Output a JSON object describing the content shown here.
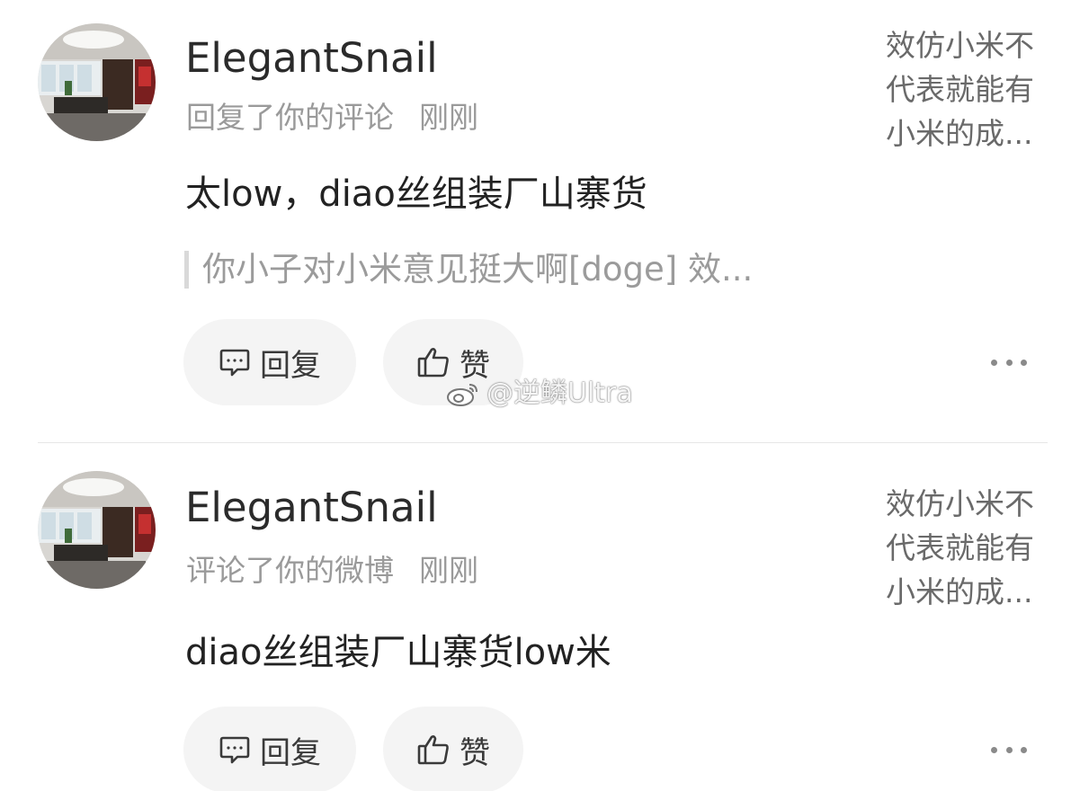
{
  "notifications": [
    {
      "username": "ElegantSnail",
      "action": "回复了你的评论",
      "time": "刚刚",
      "content": "太low，diao丝组装厂山寨货",
      "quoted": "你小子对小米意见挺大啊[doge] 效...",
      "preview_lines": [
        "效仿小米不",
        "代表就能有",
        "小米的成..."
      ],
      "reply_label": "回复",
      "like_label": "赞"
    },
    {
      "username": "ElegantSnail",
      "action": "评论了你的微博",
      "time": "刚刚",
      "content": "diao丝组装厂山寨货low米",
      "preview_lines": [
        "效仿小米不",
        "代表就能有",
        "小米的成..."
      ],
      "reply_label": "回复",
      "like_label": "赞"
    }
  ],
  "watermark": {
    "text": "@逆鳞Ultra",
    "icon": "weibo-logo-icon"
  },
  "icons": {
    "reply": "comment-bubble-icon",
    "like": "thumbs-up-icon",
    "more": "more-dots-icon"
  },
  "colors": {
    "username": "#2b2b2b",
    "meta": "#9a9a9a",
    "content": "#222222",
    "button_bg": "#f4f4f4",
    "divider": "#e6e6e6"
  }
}
